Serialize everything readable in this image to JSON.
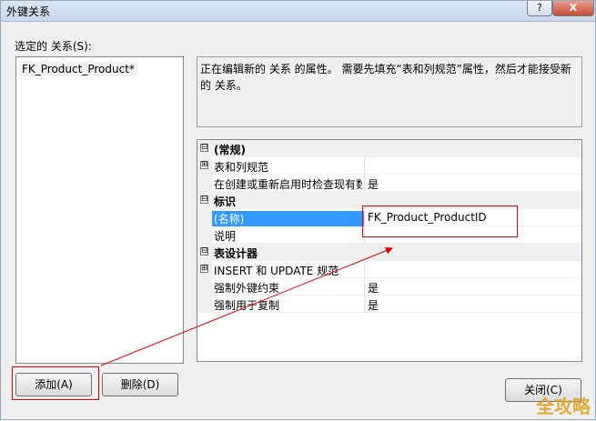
{
  "window": {
    "title": "外键关系",
    "help_label": "?",
    "close_label": "X"
  },
  "relations": {
    "label": "选定的 关系(S):",
    "items": [
      "FK_Product_Product*"
    ]
  },
  "description": "正在编辑新的 关系 的属性。 需要先填充“表和列规范”属性，然后才能接受新的 关系。",
  "properties": [
    {
      "kind": "category",
      "expander": "⊟",
      "name": "(常规)",
      "value": ""
    },
    {
      "kind": "property",
      "expander": "⊞",
      "name": "表和列规范",
      "value": ""
    },
    {
      "kind": "property",
      "expander": "",
      "name": "在创建或重新启用时检查现有数据",
      "value": "是"
    },
    {
      "kind": "category",
      "expander": "⊟",
      "name": "标识",
      "value": ""
    },
    {
      "kind": "property",
      "expander": "",
      "name": "(名称)",
      "value": "FK_Product_ProductID",
      "selected": true
    },
    {
      "kind": "property",
      "expander": "",
      "name": "说明",
      "value": ""
    },
    {
      "kind": "category",
      "expander": "⊟",
      "name": "表设计器",
      "value": ""
    },
    {
      "kind": "property",
      "expander": "⊞",
      "name": "INSERT 和 UPDATE 规范",
      "value": ""
    },
    {
      "kind": "property",
      "expander": "",
      "name": "强制外键约束",
      "value": "是"
    },
    {
      "kind": "property",
      "expander": "",
      "name": "强制用于复制",
      "value": "是"
    }
  ],
  "buttons": {
    "add": "添加(A)",
    "delete": "删除(D)",
    "close": "关闭(C)"
  },
  "watermark": "全攻略",
  "colors": {
    "selection": "#3399ff",
    "annotation": "#e00000"
  }
}
